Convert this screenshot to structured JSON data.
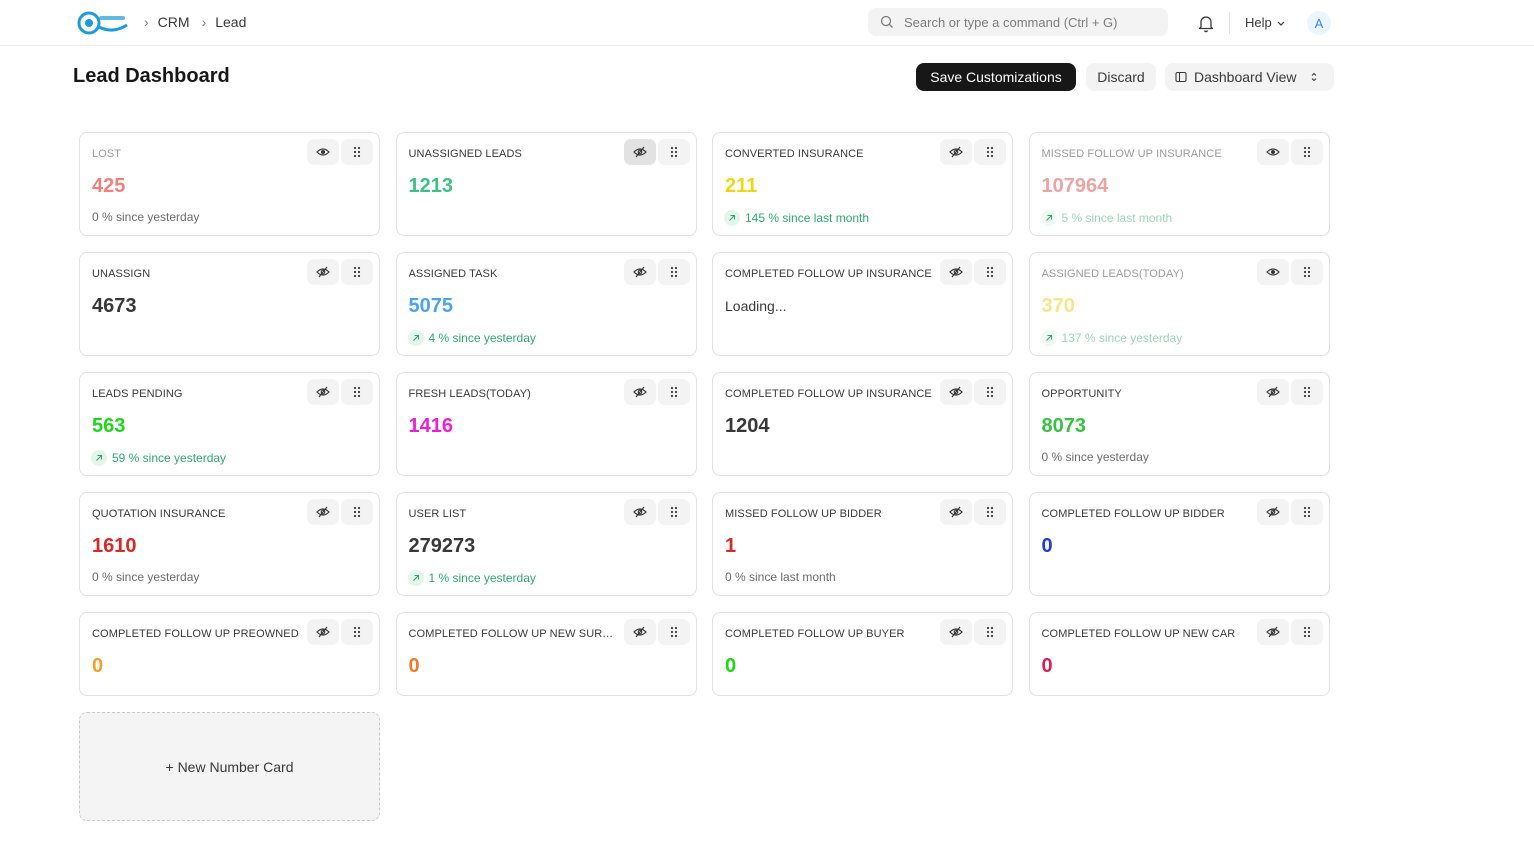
{
  "nav": {
    "breadcrumbs": [
      "CRM",
      "Lead"
    ],
    "search_placeholder": "Search or type a command (Ctrl + G)",
    "help_label": "Help",
    "avatar_initial": "A"
  },
  "header": {
    "title": "Lead Dashboard",
    "save_label": "Save Customizations",
    "discard_label": "Discard",
    "view_label": "Dashboard View"
  },
  "cards": [
    {
      "label": "LOST",
      "value": "425",
      "color": "#f07f7f",
      "stat": "0 % since yesterday",
      "trend": "flat",
      "dim": true,
      "eye": "visible"
    },
    {
      "label": "UNASSIGNED LEADS",
      "value": "1213",
      "color": "#3fbe85",
      "stat": "",
      "trend": "none",
      "dim": false,
      "eye": "hidden-active"
    },
    {
      "label": "CONVERTED INSURANCE",
      "value": "211",
      "color": "#ecd715",
      "stat": "145 % since last month",
      "trend": "up",
      "dim": false,
      "eye": "hidden"
    },
    {
      "label": "MISSED FOLLOW UP INSURANCE",
      "value": "107964",
      "color": "#e9a5a5",
      "stat": "5 % since last month",
      "trend": "up",
      "dim": true,
      "eye": "visible"
    },
    {
      "label": "UNASSIGN",
      "value": "4673",
      "color": "#383838",
      "stat": "",
      "trend": "none",
      "dim": false,
      "eye": "hidden"
    },
    {
      "label": "ASSIGNED TASK",
      "value": "5075",
      "color": "#4ba3ee",
      "stat": "4 % since yesterday",
      "trend": "up",
      "dim": false,
      "eye": "hidden"
    },
    {
      "label": "COMPLETED FOLLOW UP INSURANCE",
      "value": "",
      "loading": "Loading...",
      "color": "#383838",
      "stat": "",
      "trend": "none",
      "dim": false,
      "eye": "hidden"
    },
    {
      "label": "ASSIGNED LEADS(TODAY)",
      "value": "370",
      "color": "#f7e58e",
      "stat": "137 % since yesterday",
      "trend": "up",
      "dim": true,
      "eye": "visible"
    },
    {
      "label": "LEADS PENDING",
      "value": "563",
      "color": "#22d41d",
      "stat": "59 % since yesterday",
      "trend": "up",
      "dim": false,
      "eye": "hidden"
    },
    {
      "label": "FRESH LEADS(TODAY)",
      "value": "1416",
      "color": "#ec1fd7",
      "stat": "",
      "trend": "none",
      "dim": false,
      "eye": "hidden"
    },
    {
      "label": "COMPLETED FOLLOW UP INSURANCE",
      "value": "1204",
      "color": "#383838",
      "stat": "",
      "trend": "none",
      "dim": false,
      "eye": "hidden"
    },
    {
      "label": "OPPORTUNITY",
      "value": "8073",
      "color": "#3bc142",
      "stat": "0 % since yesterday",
      "trend": "flat",
      "dim": false,
      "eye": "hidden"
    },
    {
      "label": "QUOTATION INSURANCE",
      "value": "1610",
      "color": "#d62a2a",
      "stat": "0 % since yesterday",
      "trend": "flat",
      "dim": false,
      "eye": "hidden"
    },
    {
      "label": "USER LIST",
      "value": "279273",
      "color": "#383838",
      "stat": "1 % since yesterday",
      "trend": "up",
      "dim": false,
      "eye": "hidden"
    },
    {
      "label": "MISSED FOLLOW UP BIDDER",
      "value": "1",
      "color": "#d62a2a",
      "stat": "0 % since last month",
      "trend": "flat",
      "dim": false,
      "eye": "hidden"
    },
    {
      "label": "COMPLETED FOLLOW UP BIDDER",
      "value": "0",
      "color": "#1f3bd1",
      "stat": "",
      "trend": "none",
      "dim": false,
      "eye": "hidden"
    },
    {
      "label": "COMPLETED FOLLOW UP PREOWNED",
      "value": "0",
      "color": "#f0a02a",
      "stat": "",
      "trend": "none",
      "dim": false,
      "eye": "hidden",
      "short": true
    },
    {
      "label": "COMPLETED FOLLOW UP NEW SURVEY",
      "value": "0",
      "color": "#f07a2a",
      "stat": "",
      "trend": "none",
      "dim": false,
      "eye": "hidden",
      "short": true
    },
    {
      "label": "COMPLETED FOLLOW UP BUYER",
      "value": "0",
      "color": "#22d41d",
      "stat": "",
      "trend": "none",
      "dim": false,
      "eye": "hidden",
      "short": true
    },
    {
      "label": "COMPLETED FOLLOW UP NEW CAR",
      "value": "0",
      "color": "#d61f5a",
      "stat": "",
      "trend": "none",
      "dim": false,
      "eye": "hidden",
      "short": true
    }
  ],
  "new_card_label": "+ New Number Card"
}
